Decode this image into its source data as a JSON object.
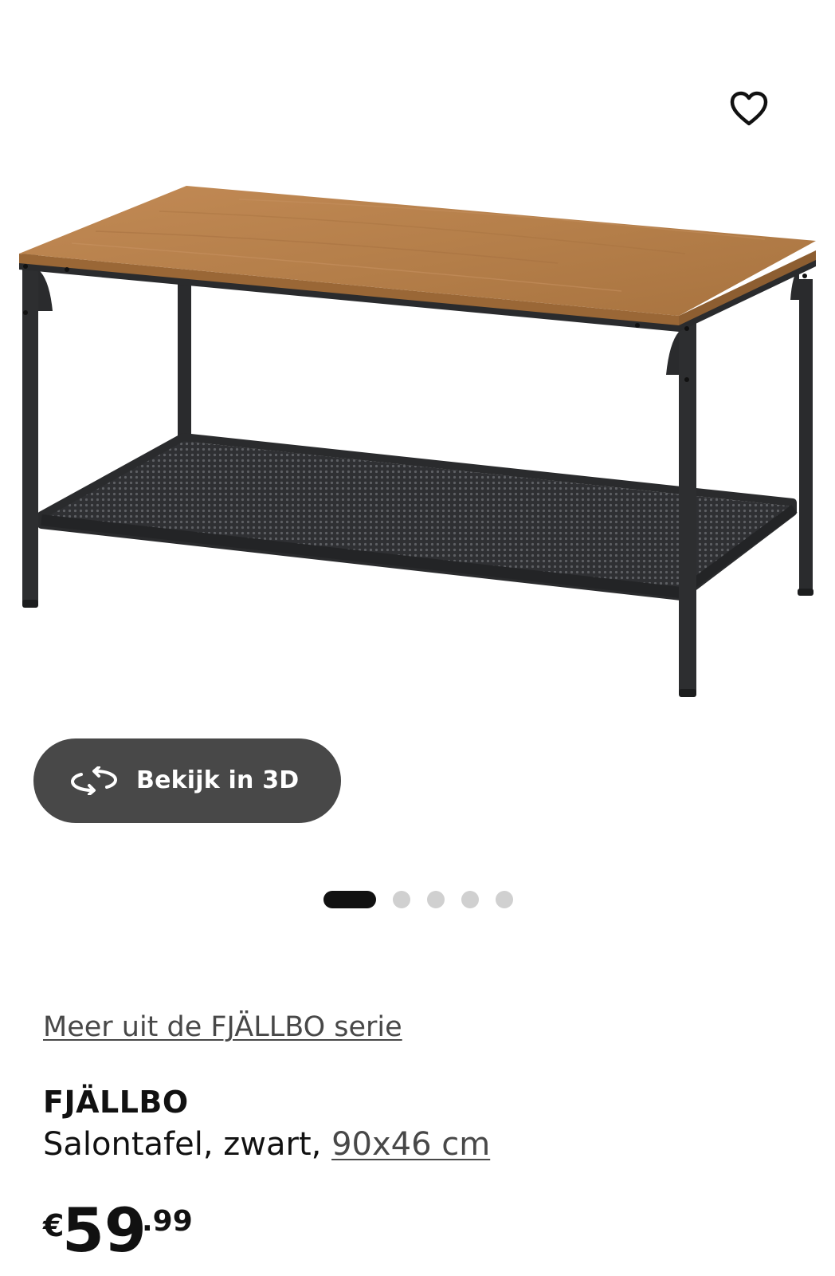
{
  "header": {
    "favorite_icon": "heart-outline-icon"
  },
  "gallery": {
    "view_3d": {
      "icon": "rotate-3d-icon",
      "label": "Bekijk in 3D"
    },
    "pagination": {
      "total": 5,
      "active_index": 0
    }
  },
  "product": {
    "series_link": "Meer uit de FJÄLLBO serie",
    "name": "FJÄLLBO",
    "description": "Salontafel, zwart, ",
    "size_link": "90x46 cm",
    "price": {
      "currency": "€",
      "integer": "59",
      "decimal": ".99"
    }
  },
  "colors": {
    "text": "#111111",
    "link": "#484848",
    "button_bg": "#484848",
    "dot_active": "#111111",
    "dot_inactive": "#d0d0d0",
    "wood": "#b57f4a",
    "frame": "#2e2f31"
  }
}
